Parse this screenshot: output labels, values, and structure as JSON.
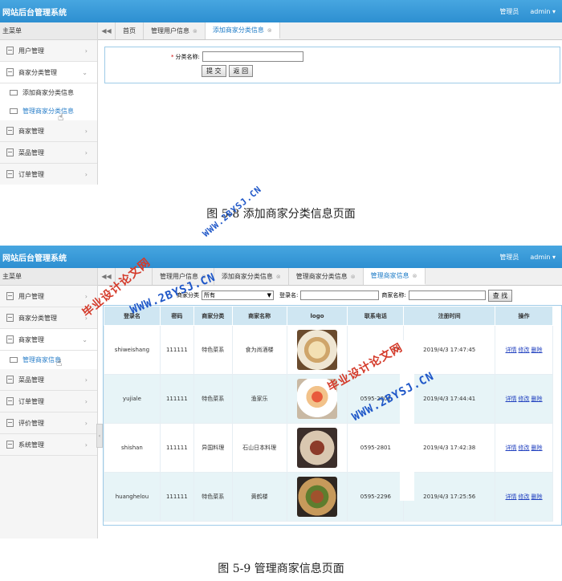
{
  "app": {
    "title": "网站后台管理系统",
    "role": "管理员",
    "user": "admin",
    "user_caret": "▾"
  },
  "shot1": {
    "sidebar": {
      "head": "主菜单",
      "items": [
        {
          "label": "用户管理",
          "arrow": "›"
        },
        {
          "label": "商家分类管理",
          "arrow": "⌄"
        },
        {
          "label": "商家管理",
          "arrow": "›"
        },
        {
          "label": "菜品管理",
          "arrow": "›"
        },
        {
          "label": "订单管理",
          "arrow": "›"
        }
      ],
      "subs": [
        "添加商家分类信息",
        "管理商家分类信息"
      ]
    },
    "tabs": [
      "首页",
      "管理用户信息",
      "添加商家分类信息"
    ],
    "form": {
      "required_mark": "*",
      "label": "分类名称:",
      "submit": "提 交",
      "back": "返 回"
    }
  },
  "caption1": "图 5-8 添加商家分类信息页面",
  "shot2": {
    "sidebar": {
      "head": "主菜单",
      "items": [
        {
          "label": "用户管理",
          "arrow": "›"
        },
        {
          "label": "商家分类管理",
          "arrow": "›"
        },
        {
          "label": "商家管理",
          "arrow": "⌄"
        },
        {
          "label": "菜品管理",
          "arrow": "›"
        },
        {
          "label": "订单管理",
          "arrow": "›"
        },
        {
          "label": "评价管理",
          "arrow": "›"
        },
        {
          "label": "系统管理",
          "arrow": "›"
        }
      ],
      "subs": [
        "管理商家信息"
      ],
      "toggle": "‹"
    },
    "tabs": [
      "管理用户信息",
      "添加商家分类信息",
      "管理商家分类信息",
      "管理商家信息"
    ],
    "search": {
      "category_label": "商家分类",
      "category_value": "所有",
      "login_label": "登录名:",
      "name_label": "商家名称:",
      "button": "查 找"
    },
    "table": {
      "headers": [
        "登录名",
        "密码",
        "商家分类",
        "商家名称",
        "logo",
        "联系电话",
        "注册时间",
        "操作"
      ],
      "rows": [
        {
          "login": "shiweishang",
          "password": "111111",
          "category": "特色菜系",
          "name": "食为尚酒楼",
          "phone": "772",
          "time": "2019/4/3 17:47:45"
        },
        {
          "login": "yujiale",
          "password": "111111",
          "category": "特色菜系",
          "name": "渔家乐",
          "phone": "0595-2802",
          "time": "2019/4/3 17:44:41"
        },
        {
          "login": "shishan",
          "password": "111111",
          "category": "异国料理",
          "name": "石山日本料理",
          "phone": "0595-2801",
          "time": "2019/4/3 17:42:38"
        },
        {
          "login": "huanghelou",
          "password": "111111",
          "category": "特色菜系",
          "name": "黄鹤楼",
          "phone": "0595-2296",
          "time": "2019/4/3 17:25:56"
        }
      ],
      "ops": [
        "详情",
        "修改",
        "删除"
      ]
    }
  },
  "caption2": "图 5-9 管理商家信息页面",
  "watermarks": [
    "WWW.2BYSJ.CN",
    "毕业设计论文网",
    "WWW.2BYSJ.CN",
    "毕业设计论文网",
    "WWW.2BYSJ.CN"
  ]
}
